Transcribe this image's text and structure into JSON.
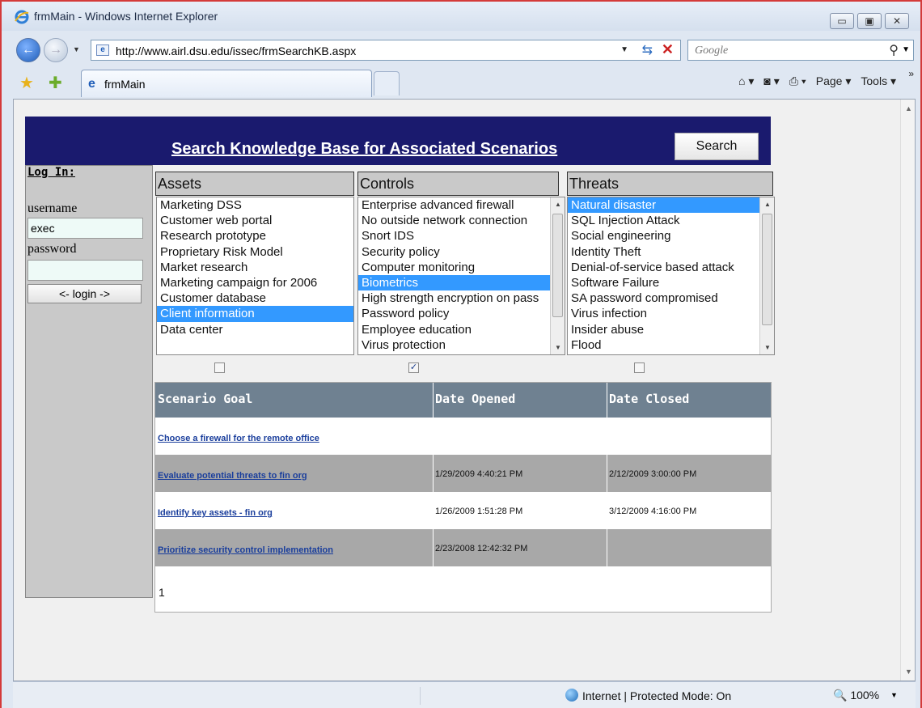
{
  "window": {
    "title": "frmMain - Windows Internet Explorer",
    "controls": [
      "▭",
      "▣",
      "✕"
    ]
  },
  "address_bar": {
    "url": "http://www.airl.dsu.edu/issec/frmSearchKB.aspx",
    "search_placeholder": "Google"
  },
  "tab": {
    "label": "frmMain"
  },
  "command_bar": {
    "home": "⌂ ▾",
    "feeds": "◙ ▾",
    "print": "⎙ ▾",
    "page": "Page ▾",
    "tools": "Tools ▾"
  },
  "page": {
    "banner_title": "Search Knowledge Base for Associated Scenarios",
    "search_button": "Search",
    "login": {
      "title": "Log In:",
      "username_label": "username",
      "username_value": "exec",
      "password_label": "password",
      "login_button": "<- login ->"
    },
    "assets": {
      "header": "Assets",
      "items": [
        "Marketing DSS",
        "Customer web portal",
        "Research prototype",
        "Proprietary Risk Model",
        "Market research",
        "Marketing campaign for 2006",
        "Customer database",
        "Client information",
        "Data center"
      ],
      "selected": "Client information",
      "checked": false
    },
    "controls": {
      "header": "Controls",
      "items": [
        "Enterprise advanced firewall",
        "No outside network connection",
        "Snort IDS",
        "Security policy",
        "Computer monitoring",
        "Biometrics",
        "High strength encryption on pass",
        "Password policy",
        "Employee education",
        "Virus protection"
      ],
      "selected": "Biometrics",
      "checked": true
    },
    "threats": {
      "header": "Threats",
      "items": [
        "Natural disaster",
        "SQL Injection Attack",
        "Social engineering",
        "Identity Theft",
        "Denial-of-service based attack",
        "Software Failure",
        "SA password compromised",
        "Virus infection",
        "Insider abuse",
        "Flood"
      ],
      "selected": "Natural disaster",
      "checked": false
    },
    "grid": {
      "columns": [
        "Scenario Goal",
        "Date Opened",
        "Date Closed"
      ],
      "rows": [
        {
          "goal": "Choose a firewall for the remote office",
          "opened": "",
          "closed": ""
        },
        {
          "goal": "Evaluate potential threats to fin org",
          "opened": "1/29/2009 4:40:21 PM",
          "closed": "2/12/2009 3:00:00 PM"
        },
        {
          "goal": "Identify key assets - fin org",
          "opened": "1/26/2009 1:51:28 PM",
          "closed": "3/12/2009 4:16:00 PM"
        },
        {
          "goal": "Prioritize security control implementation",
          "opened": "2/23/2008 12:42:32 PM",
          "closed": ""
        }
      ],
      "pager": "1"
    }
  },
  "status_bar": {
    "zone": "Internet | Protected Mode: On",
    "zoom": "100%"
  }
}
